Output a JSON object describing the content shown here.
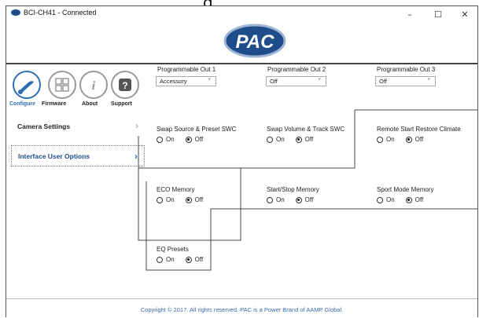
{
  "window": {
    "title": "BCI-CH41 - Connected",
    "header_partial_text": "g",
    "minimize": "–",
    "maximize": "☐",
    "close": "✕"
  },
  "logo": {
    "text": "PAC",
    "color": "#1f4d8c"
  },
  "nav": {
    "items": [
      {
        "label": "Configure",
        "icon": "wrench-plug-icon",
        "active": true
      },
      {
        "label": "Firmware",
        "icon": "grid-icon",
        "active": false
      },
      {
        "label": "About",
        "icon": "info-icon",
        "active": false
      },
      {
        "label": "Support",
        "icon": "question-icon",
        "active": false
      }
    ],
    "info_glyph": "i",
    "question_glyph": "?"
  },
  "sidebar": {
    "items": [
      {
        "label": "Camera Settings",
        "chevron": "›",
        "active": false
      },
      {
        "label": "Interface User Options",
        "chevron": "›",
        "active": true
      }
    ]
  },
  "outputs": [
    {
      "label": "Programmable Out 1",
      "value": "Accessory"
    },
    {
      "label": "Programmable Out 2",
      "value": "Off"
    },
    {
      "label": "Programmable Out 3",
      "value": "Off"
    }
  ],
  "caret": "˅",
  "options": {
    "on_label": "On",
    "off_label": "Off",
    "items": [
      {
        "label": "Swap Source & Preset SWC",
        "selected": "Off"
      },
      {
        "label": "Swap Volume & Track SWC",
        "selected": "Off"
      },
      {
        "label": "Remote Start Restore Climate",
        "selected": "Off"
      },
      {
        "label": "ECO Memory",
        "selected": "Off"
      },
      {
        "label": "Start/Stop Memory",
        "selected": "Off"
      },
      {
        "label": "Sport Mode Memory",
        "selected": "Off"
      },
      {
        "label": "EQ Presets",
        "selected": "Off"
      }
    ]
  },
  "footer": {
    "text": "Copyright © 2017. All rights reserved. PAC is a Power Brand of AAMP Global."
  },
  "colors": {
    "accent": "#2f6db3",
    "brand": "#1f4d8c"
  }
}
